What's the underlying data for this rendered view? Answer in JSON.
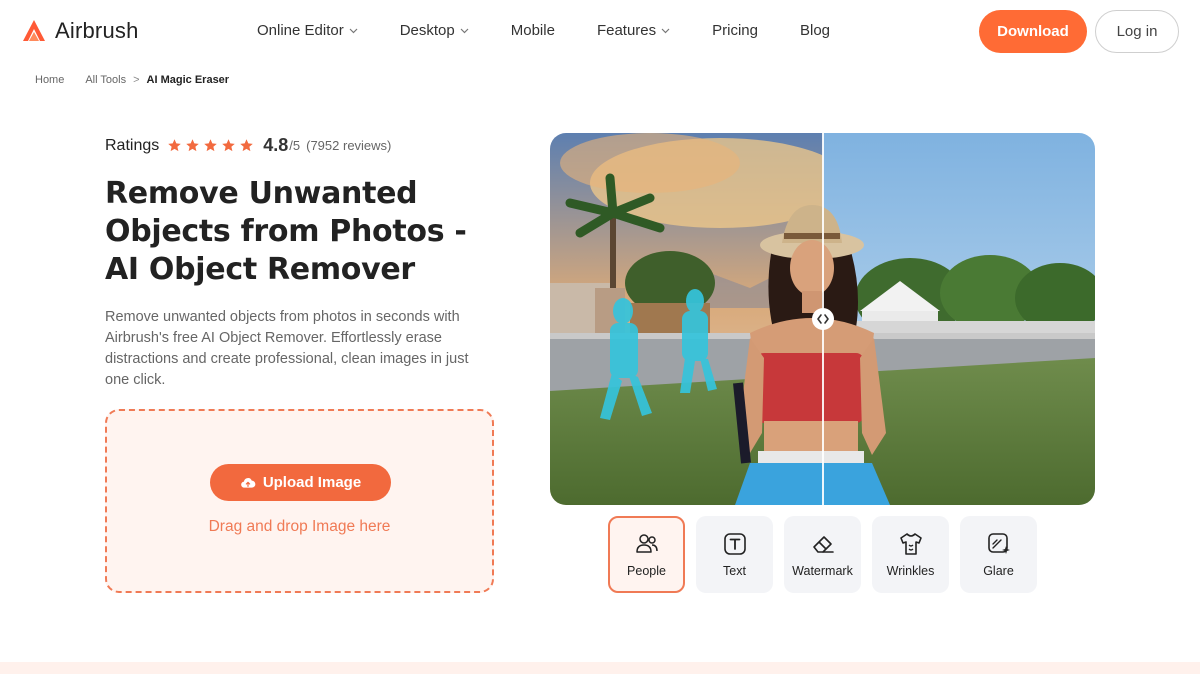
{
  "brand": {
    "name": "Airbrush",
    "accent": "#ff6b35"
  },
  "nav": {
    "items": [
      {
        "label": "Online Editor",
        "has_dropdown": true
      },
      {
        "label": "Desktop",
        "has_dropdown": true
      },
      {
        "label": "Mobile",
        "has_dropdown": false
      },
      {
        "label": "Features",
        "has_dropdown": true
      },
      {
        "label": "Pricing",
        "has_dropdown": false
      },
      {
        "label": "Blog",
        "has_dropdown": false
      }
    ],
    "download_label": "Download",
    "login_label": "Log in"
  },
  "breadcrumb": {
    "items": [
      "Home",
      "All Tools",
      "AI Magic Eraser"
    ],
    "separator": ">"
  },
  "ratings": {
    "label": "Ratings",
    "stars": 5,
    "value": "4.8",
    "out_of": "/5",
    "reviews": "(7952 reviews)"
  },
  "hero": {
    "title": "Remove Unwanted Objects from Photos - AI Object Remover",
    "description": "Remove unwanted objects from photos in seconds with Airbrush's free AI Object Remover. Effortlessly erase distractions and create professional, clean images in just one click."
  },
  "upload": {
    "button_label": "Upload Image",
    "drag_text": "Drag and drop Image here",
    "icon": "cloud-upload-icon"
  },
  "tools": {
    "active": "People",
    "items": [
      {
        "label": "People",
        "icon": "people-icon"
      },
      {
        "label": "Text",
        "icon": "text-icon"
      },
      {
        "label": "Watermark",
        "icon": "eraser-icon"
      },
      {
        "label": "Wrinkles",
        "icon": "shirt-icon"
      },
      {
        "label": "Glare",
        "icon": "glare-icon"
      }
    ]
  }
}
